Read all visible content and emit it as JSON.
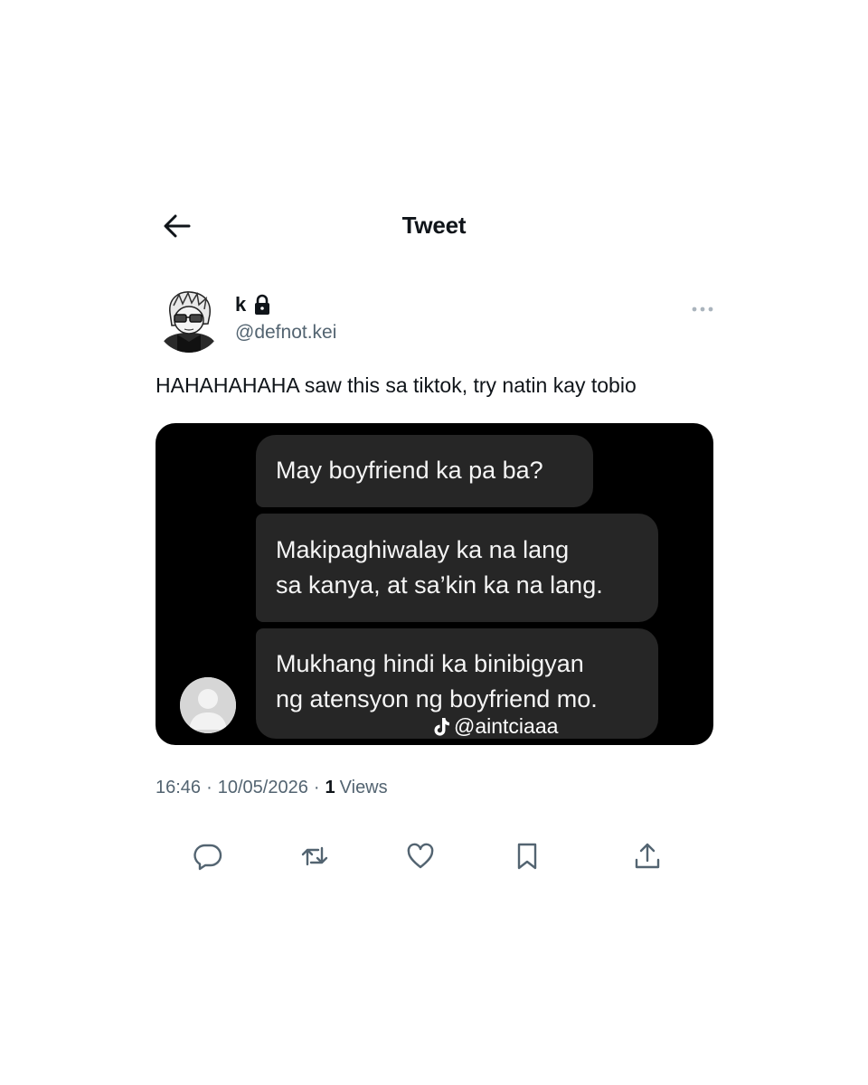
{
  "header": {
    "title": "Tweet"
  },
  "author": {
    "display_name": "k",
    "handle": "@defnot.kei",
    "protected_icon": "lock-icon",
    "avatar": "anime-character-avatar"
  },
  "tweet": {
    "text": "HAHAHAHAHA saw this sa tiktok, try natin kay tobio",
    "media": {
      "messages": [
        "May boyfriend ka pa ba?",
        "Makipaghiwalay ka na lang sa kanya, at sa’kin ka na lang.",
        "Mukhang hindi ka binibigyan ng atensyon ng boyfriend mo."
      ],
      "message_lines": [
        [
          "May boyfriend ka pa ba?"
        ],
        [
          "Makipaghiwalay ka na lang",
          "sa kanya, at sa’kin ka na lang."
        ],
        [
          "Mukhang hindi ka binibigyan",
          "ng atensyon ng boyfriend mo."
        ]
      ],
      "watermark": "@aintciaaa",
      "watermark_icon": "tiktok-icon"
    }
  },
  "meta": {
    "time": "16:46",
    "separator": "·",
    "date": "10/05/2026",
    "views_count": "1",
    "views_label": "Views"
  },
  "actions": [
    "reply-icon",
    "retweet-icon",
    "like-icon",
    "bookmark-icon",
    "share-icon"
  ],
  "colors": {
    "text_primary": "#0f1419",
    "text_secondary": "#536471",
    "media_background": "#000000",
    "bubble_background": "#262626",
    "icon_color": "#536471"
  }
}
